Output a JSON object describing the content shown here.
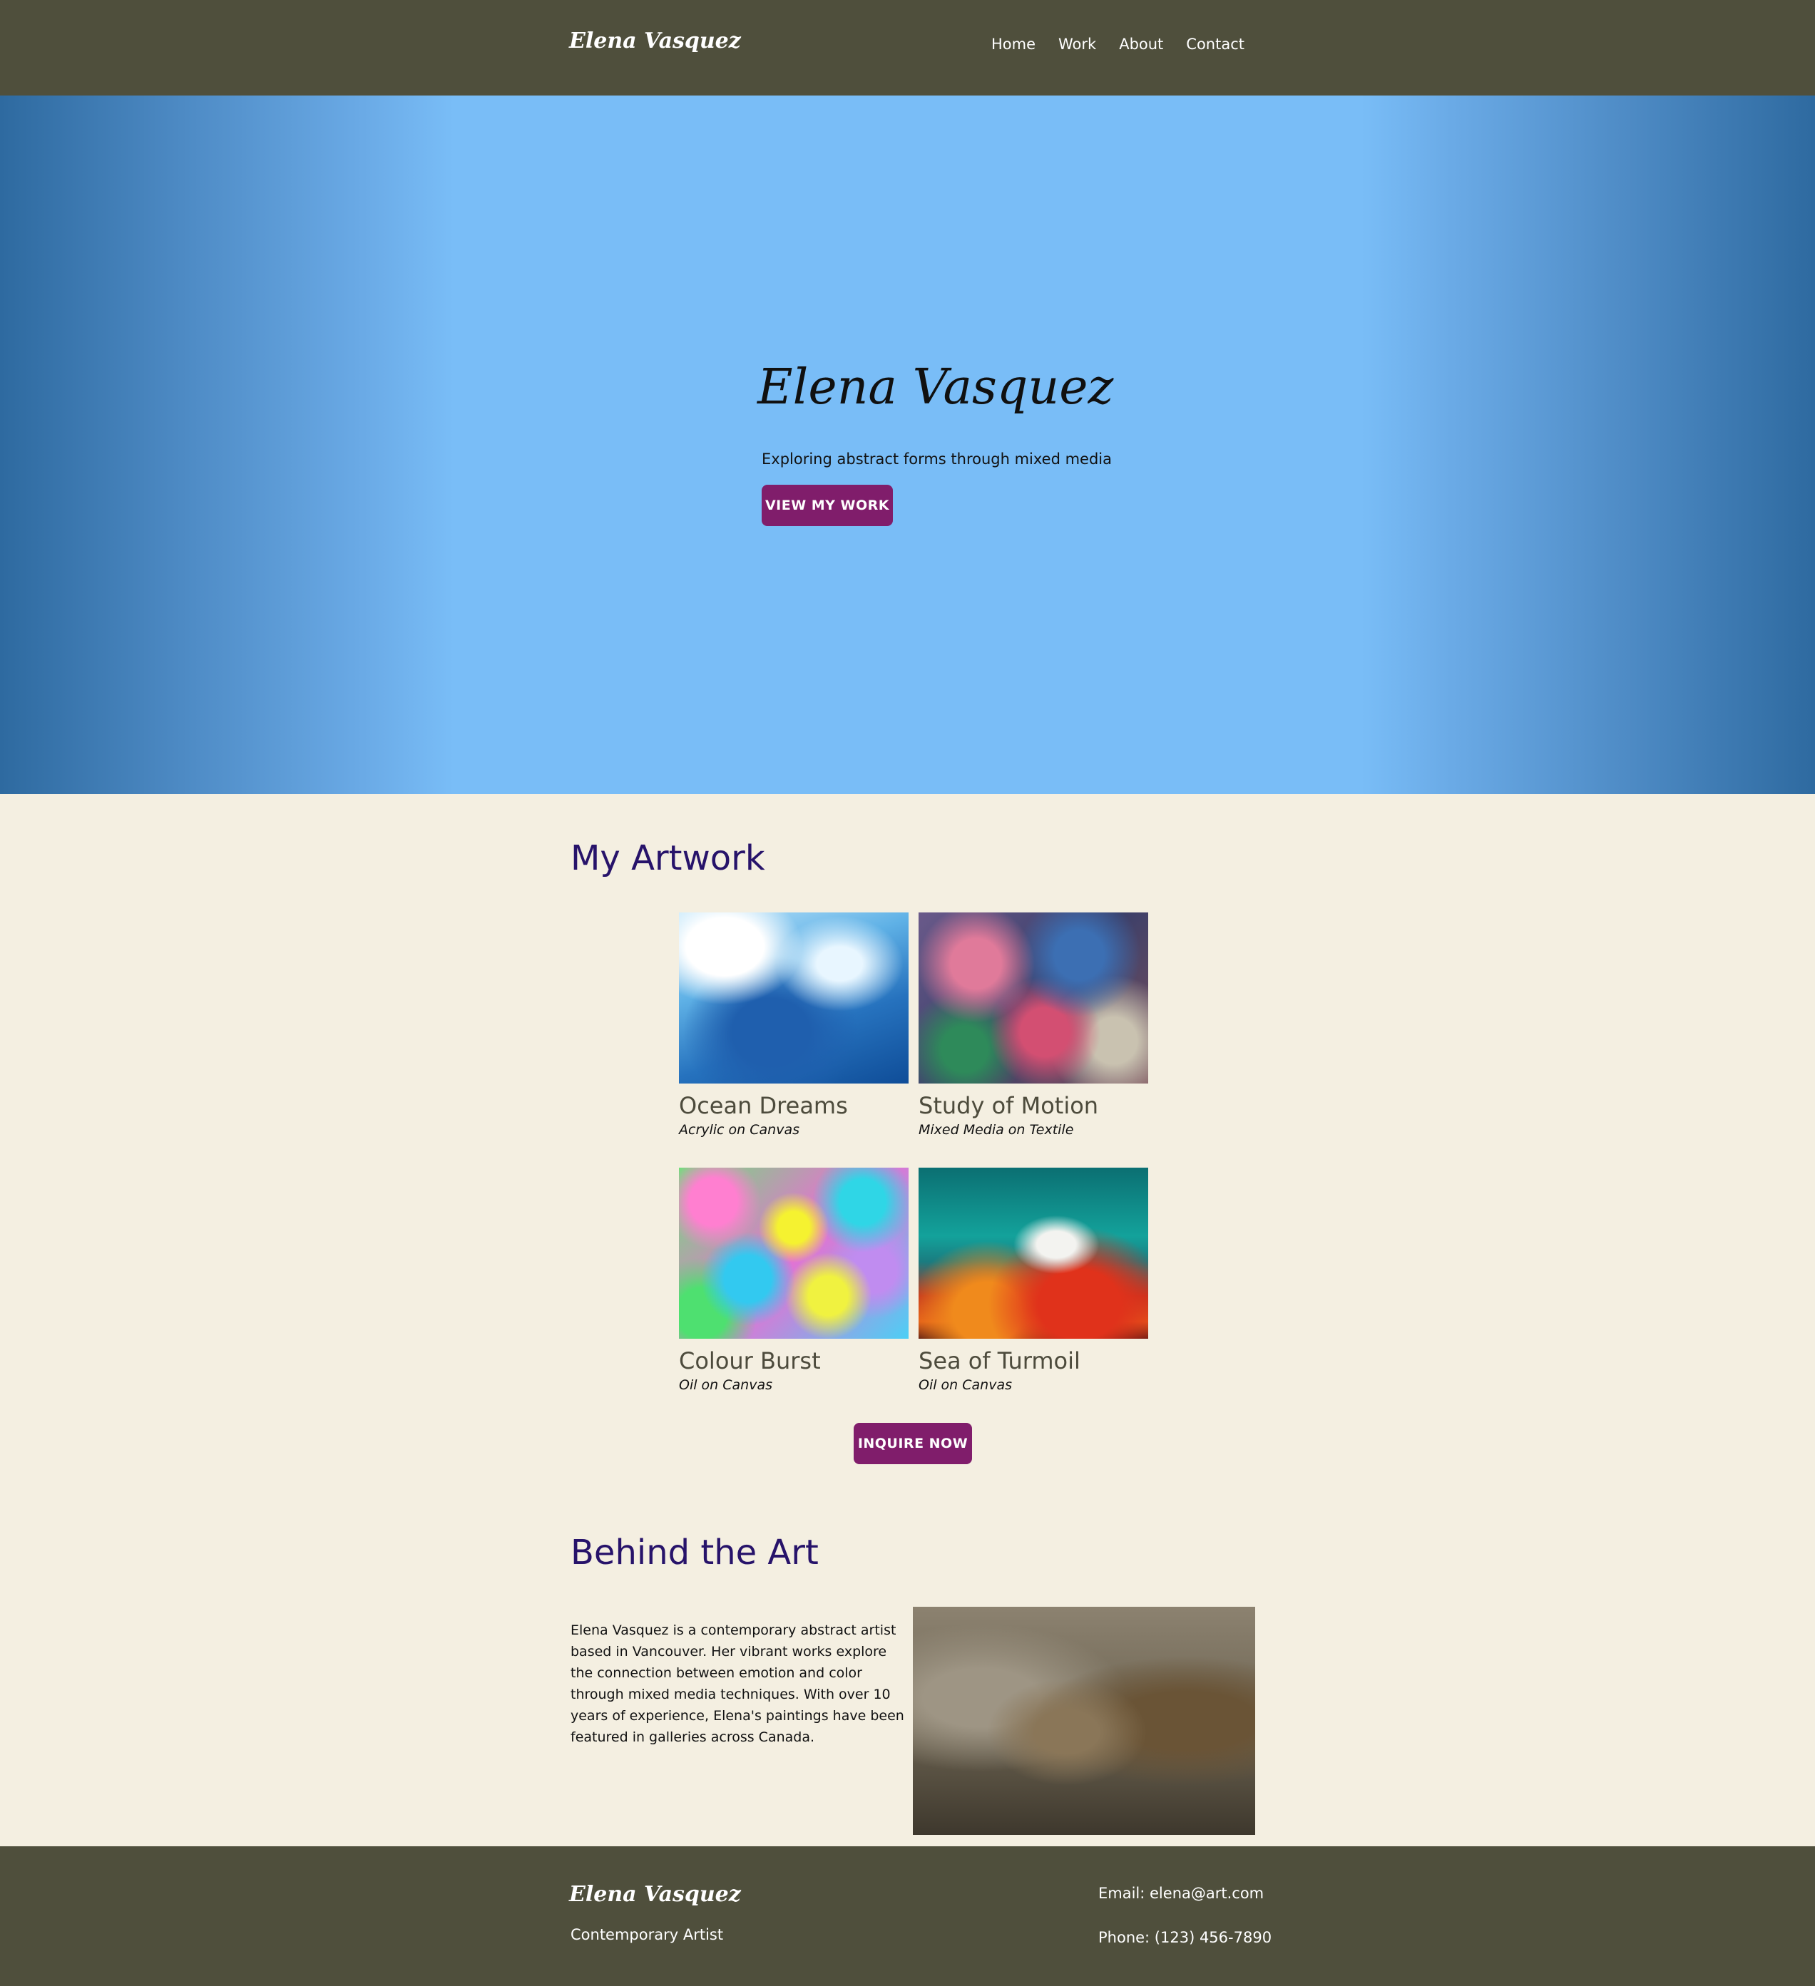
{
  "nav": {
    "logo": "Elena Vasquez",
    "links": [
      "Home",
      "Work",
      "About",
      "Contact"
    ]
  },
  "hero": {
    "title": "Elena Vasquez",
    "subtitle": "Exploring abstract forms through mixed media",
    "cta": "VIEW MY WORK"
  },
  "artwork": {
    "heading": "My Artwork",
    "items": [
      {
        "title": "Ocean Dreams",
        "medium": "Acrylic on Canvas"
      },
      {
        "title": "Study of Motion",
        "medium": "Mixed Media on Textile"
      },
      {
        "title": "Colour Burst",
        "medium": "Oil on Canvas"
      },
      {
        "title": "Sea of Turmoil",
        "medium": "Oil on Canvas"
      }
    ],
    "cta": "INQUIRE NOW"
  },
  "behind": {
    "heading": "Behind the Art",
    "bio": "Elena Vasquez is a contemporary abstract artist based in Vancouver. Her vibrant works explore the connection between emotion and color through mixed media techniques. With over 10 years of experience, Elena's paintings have been featured in galleries across Canada."
  },
  "footer": {
    "logo": "Elena Vasquez",
    "tagline": "Contemporary Artist",
    "email": "Email: elena@art.com",
    "phone": "Phone: (123) 456-7890"
  },
  "colors": {
    "nav_bg": "#4f4f3c",
    "hero_blue": "#79bdf7",
    "accent": "#801d6b",
    "heading": "#27136a",
    "page_bg": "#f4efe1"
  }
}
